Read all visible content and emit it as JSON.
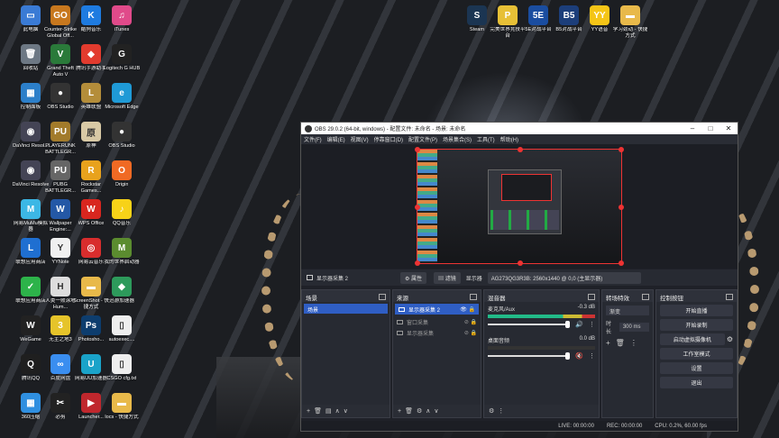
{
  "colors": {
    "accent": "#2f5ec4",
    "selection_border": "#e33333"
  },
  "desktop_icons": [
    {
      "label": "此电脑",
      "icon": "computer-icon",
      "color": "#3a7bd5",
      "glyph": "▭"
    },
    {
      "label": "Counter-Strike Global Off...",
      "icon": "csgo-icon",
      "color": "#c8781e",
      "glyph": "GO"
    },
    {
      "label": "酷狗音乐",
      "icon": "kugou-icon",
      "color": "#1e7be0",
      "glyph": "K"
    },
    {
      "label": "iTunes",
      "icon": "itunes-icon",
      "color": "#e04a8a",
      "glyph": "♫"
    },
    {
      "label": "回收站",
      "icon": "recycle-bin-icon",
      "color": "#6d7884",
      "glyph": "🗑"
    },
    {
      "label": "Grand Theft Auto V",
      "icon": "gta-icon",
      "color": "#2a7a3a",
      "glyph": "V"
    },
    {
      "label": "腾讯手游助手",
      "icon": "tencent-mobile-icon",
      "color": "#e23b2e",
      "glyph": "◆"
    },
    {
      "label": "Logitech G HUB",
      "icon": "logitech-icon",
      "color": "#222",
      "glyph": "G"
    },
    {
      "label": "控制面板",
      "icon": "control-panel-icon",
      "color": "#2c7fc9",
      "glyph": "▦"
    },
    {
      "label": "OBS Studio",
      "icon": "obs-icon",
      "color": "#333",
      "glyph": "●"
    },
    {
      "label": "英雄联盟",
      "icon": "lol-icon",
      "color": "#b48d3a",
      "glyph": "L"
    },
    {
      "label": "Microsoft Edge",
      "icon": "edge-icon",
      "color": "#1f9ad6",
      "glyph": "e"
    },
    {
      "label": "DaVinci Resol...",
      "icon": "davinci-icon",
      "color": "#445",
      "glyph": "◉"
    },
    {
      "label": "PLAYERUNK BATTLEGR...",
      "icon": "pubg-icon",
      "color": "#a27b2b",
      "glyph": "PU"
    },
    {
      "label": "原神",
      "icon": "genshin-icon",
      "color": "#d8c9a5",
      "glyph": "原"
    },
    {
      "label": "OBS Studio",
      "icon": "obs-icon",
      "color": "#333",
      "glyph": "●"
    },
    {
      "label": "DaVinci Resolve",
      "icon": "davinci-icon",
      "color": "#445",
      "glyph": "◉"
    },
    {
      "label": "PUBG BATTLEGR...",
      "icon": "pubg-icon",
      "color": "#666",
      "glyph": "PU"
    },
    {
      "label": "Rockstar Games...",
      "icon": "rockstar-icon",
      "color": "#e8a21d",
      "glyph": "R"
    },
    {
      "label": "Origin",
      "icon": "origin-icon",
      "color": "#f06a24",
      "glyph": "O"
    },
    {
      "label": "网易MuMu模拟器",
      "icon": "mumu-icon",
      "color": "#3cb7e5",
      "glyph": "M"
    },
    {
      "label": "Wallpaper Engine:...",
      "icon": "wallpaper-engine-icon",
      "color": "#2458a6",
      "glyph": "W"
    },
    {
      "label": "WPS Office",
      "icon": "wps-icon",
      "color": "#d8261f",
      "glyph": "W"
    },
    {
      "label": "QQ音乐",
      "icon": "qq-music-icon",
      "color": "#f7d218",
      "glyph": "♪"
    },
    {
      "label": "联想应用商店",
      "icon": "lenovo-store-icon",
      "color": "#1f6fd1",
      "glyph": "L"
    },
    {
      "label": "YYNote",
      "icon": "yynote-icon",
      "color": "#f0f0f0",
      "glyph": "Y"
    },
    {
      "label": "网易云音乐",
      "icon": "netease-music-icon",
      "color": "#d82d2d",
      "glyph": "◎"
    },
    {
      "label": "我的世界启动器",
      "icon": "minecraft-icon",
      "color": "#5b8c2f",
      "glyph": "M"
    },
    {
      "label": "联想应用商店",
      "icon": "lenovo-store-icon",
      "color": "#2db34a",
      "glyph": "✓"
    },
    {
      "label": "人类一败涂地 Hum...",
      "icon": "human-fall-flat-icon",
      "color": "#ddd",
      "glyph": "H"
    },
    {
      "label": "ScreenShot - 快捷方式",
      "icon": "folder-icon",
      "color": "#e8b94a",
      "glyph": "▬"
    },
    {
      "label": "迅游加速器",
      "icon": "xunyou-icon",
      "color": "#2d9a5b",
      "glyph": "◆"
    },
    {
      "label": "WeGame",
      "icon": "wegame-icon",
      "color": "#222",
      "glyph": "W"
    },
    {
      "label": "无主之地3",
      "icon": "borderlands-icon",
      "color": "#e6c42a",
      "glyph": "3"
    },
    {
      "label": "Photosho...",
      "icon": "photoshop-icon",
      "color": "#0d3d6e",
      "glyph": "Ps"
    },
    {
      "label": "autoexec....",
      "icon": "file-icon",
      "color": "#eee",
      "glyph": "▯"
    },
    {
      "label": "腾讯QQ",
      "icon": "qq-icon",
      "color": "#1f1f1f",
      "glyph": "Q"
    },
    {
      "label": "百度网盘",
      "icon": "baidu-netdisk-icon",
      "color": "#3a8ef0",
      "glyph": "∞"
    },
    {
      "label": "网易UU加速器",
      "icon": "uu-icon",
      "color": "#1aa3c9",
      "glyph": "U"
    },
    {
      "label": "CSGO cfg.txt",
      "icon": "text-file-icon",
      "color": "#eee",
      "glyph": "▯"
    },
    {
      "label": "360压缩",
      "icon": "360-zip-icon",
      "color": "#2f8fe0",
      "glyph": "▦"
    },
    {
      "label": "必剪",
      "icon": "bijian-icon",
      "color": "#222",
      "glyph": "✂"
    },
    {
      "label": "Launcher...",
      "icon": "launcher-icon",
      "color": "#c0272d",
      "glyph": "▶"
    },
    {
      "label": "locs - 快捷方式",
      "icon": "folder-icon",
      "color": "#e8b94a",
      "glyph": "▬"
    },
    {
      "label": "Steam",
      "icon": "steam-icon",
      "color": "#1b3552",
      "glyph": "S"
    },
    {
      "label": "完美世界竞技平台",
      "icon": "perfect-world-icon",
      "color": "#e7c036",
      "glyph": "P"
    },
    {
      "label": "5E对战平台",
      "icon": "5e-icon",
      "color": "#1a4da0",
      "glyph": "5E"
    },
    {
      "label": "B5对战平台",
      "icon": "b5-icon",
      "color": "#1c3e7a",
      "glyph": "B5"
    },
    {
      "label": "YY语音",
      "icon": "yy-icon",
      "color": "#f5c517",
      "glyph": "YY"
    },
    {
      "label": "学习劲动 - 快捷方式",
      "icon": "folder-icon",
      "color": "#e8b94a",
      "glyph": "▬"
    }
  ],
  "obs": {
    "title": "OBS 29.0.2 (64-bit, windows) - 配置文件: 未命名 - 场景: 未命名",
    "menu": [
      "文件(F)",
      "编辑(E)",
      "视图(V)",
      "停靠窗口(D)",
      "配置文件(P)",
      "场景集合(S)",
      "工具(T)",
      "帮助(H)"
    ],
    "toolbar": {
      "source": "显示器采集 2",
      "properties": "⚙ 属性",
      "filters": "▤ 滤镜",
      "display_label": "显示器",
      "display_value": "AG273QG3R3B: 2560x1440 @ 0,0 (主显示器)"
    },
    "scenes": {
      "title": "场景",
      "items": [
        "场景"
      ]
    },
    "sources": {
      "title": "来源",
      "items": [
        "显示器采集 2",
        "窗口采集",
        "显示器采集"
      ]
    },
    "mixer": {
      "title": "混音器",
      "channels": [
        {
          "name": "麦克风/Aux",
          "db": "-0.3 dB"
        },
        {
          "name": "桌面音频",
          "db": "0.0 dB"
        }
      ]
    },
    "transitions": {
      "title": "转场特效",
      "type": "渐变",
      "duration_label": "时长",
      "duration": "300 ms"
    },
    "controls": {
      "title": "控制按钮",
      "buttons": [
        "开始直播",
        "开始录制",
        "启动虚拟摄像机",
        "工作室模式",
        "设置",
        "退出"
      ]
    },
    "status": {
      "live": "LIVE: 00:00:00",
      "rec": "REC: 00:00:00",
      "cpu": "CPU: 0.2%, 60.00 fps"
    }
  }
}
